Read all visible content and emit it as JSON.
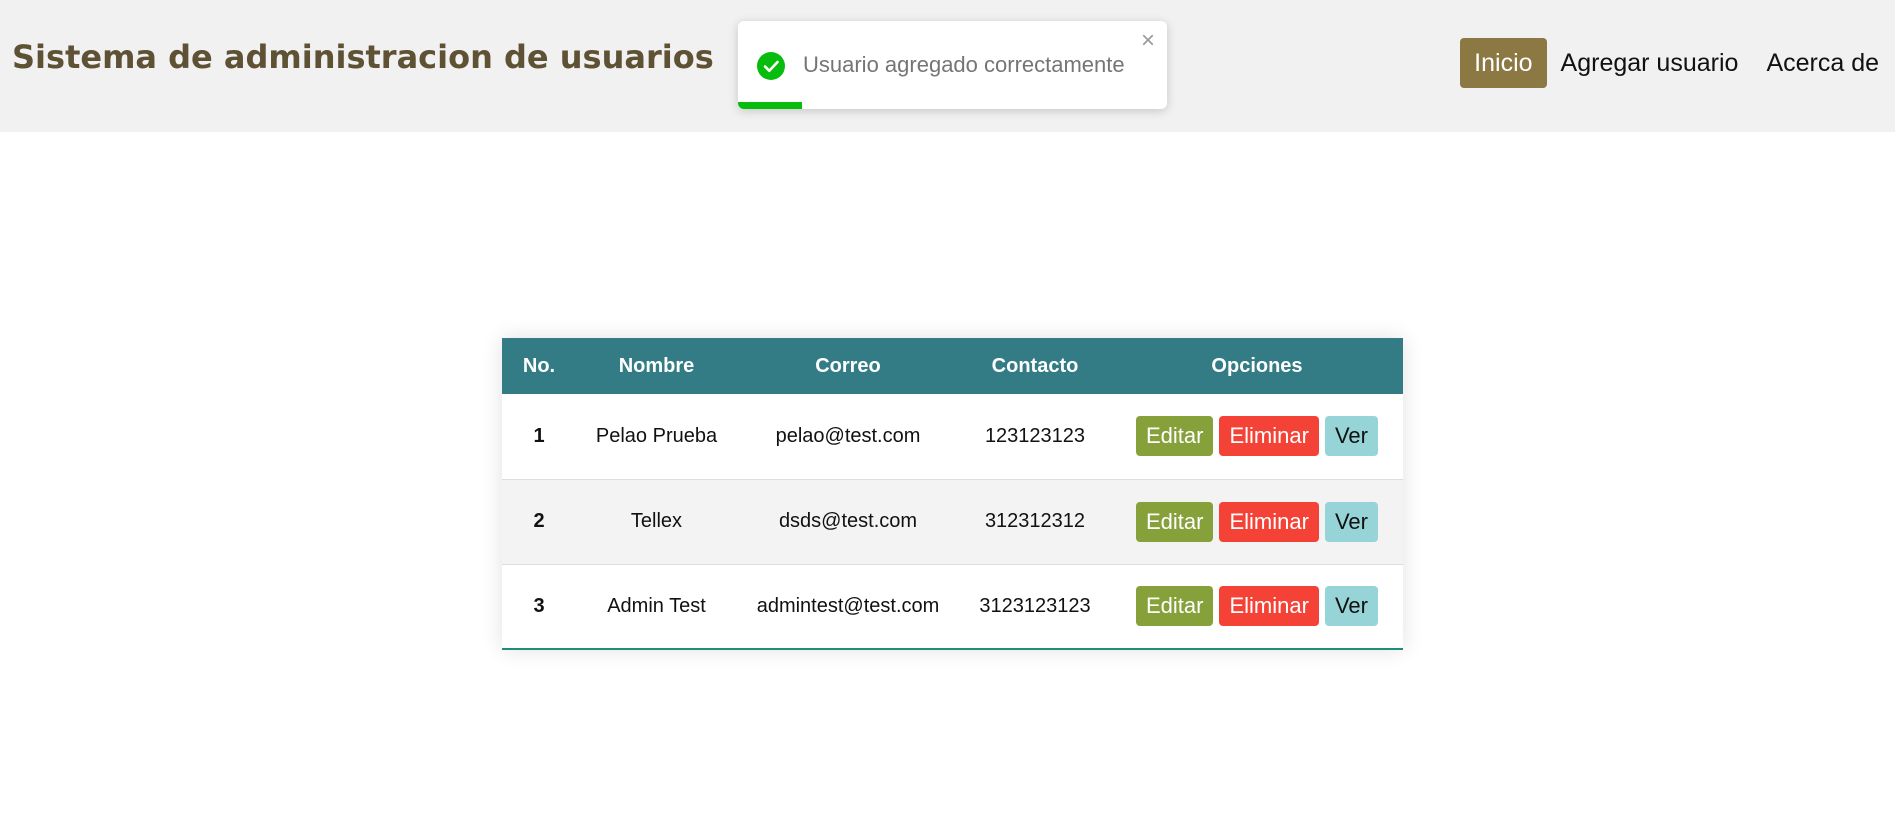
{
  "header": {
    "title": "Sistema de administracion de usuarios",
    "nav": [
      {
        "label": "Inicio",
        "active": true
      },
      {
        "label": "Agregar usuario",
        "active": false
      },
      {
        "label": "Acerca de",
        "active": false
      }
    ]
  },
  "toast": {
    "message": "Usuario agregado correctamente",
    "close_glyph": "×",
    "icon": "check-circle-icon",
    "progress": 0.15,
    "color": "#07bc0c"
  },
  "table": {
    "columns": [
      "No.",
      "Nombre",
      "Correo",
      "Contacto",
      "Opciones"
    ],
    "rows": [
      {
        "no": "1",
        "nombre": "Pelao Prueba",
        "correo": "pelao@test.com",
        "contacto": "123123123"
      },
      {
        "no": "2",
        "nombre": "Tellex",
        "correo": "dsds@test.com",
        "contacto": "312312312"
      },
      {
        "no": "3",
        "nombre": "Admin Test",
        "correo": "admintest@test.com",
        "contacto": "3123123123"
      }
    ],
    "actions": {
      "edit": "Editar",
      "delete": "Eliminar",
      "view": "Ver"
    }
  },
  "colors": {
    "header_bg": "#f1f1f1",
    "title": "#5e5134",
    "nav_active": "#8b7842",
    "table_header": "#337c85",
    "edit": "#86a03a",
    "delete": "#f44336",
    "view": "#96d4d8"
  }
}
